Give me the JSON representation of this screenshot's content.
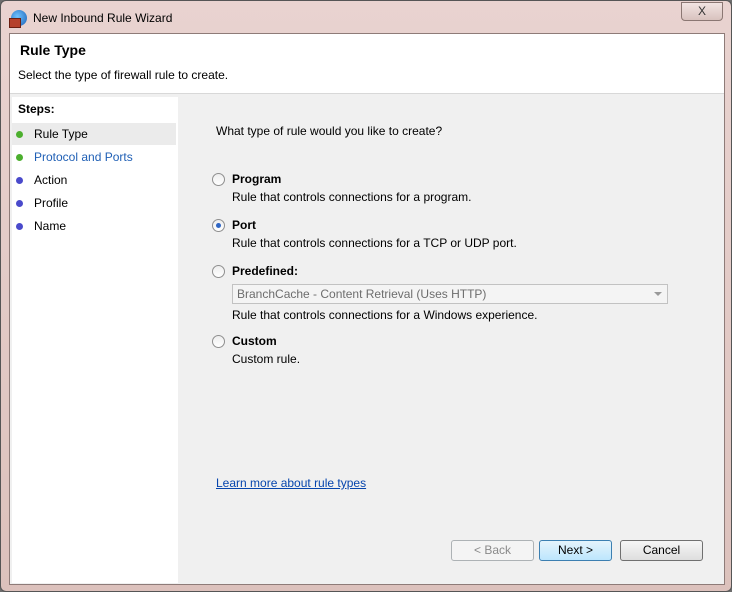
{
  "window": {
    "title": "New Inbound Rule Wizard",
    "close_label": "X"
  },
  "header": {
    "title": "Rule Type",
    "subtitle": "Select the type of firewall rule to create."
  },
  "steps": {
    "label": "Steps:",
    "items": [
      {
        "label": "Rule Type",
        "color": "#4caf2e",
        "selected": true
      },
      {
        "label": "Protocol and Ports",
        "color": "#4caf2e",
        "link": true
      },
      {
        "label": "Action",
        "color": "#4a4acb"
      },
      {
        "label": "Profile",
        "color": "#4a4acb"
      },
      {
        "label": "Name",
        "color": "#4a4acb"
      }
    ]
  },
  "main": {
    "question": "What type of rule would you like to create?",
    "options": [
      {
        "title": "Program",
        "desc": "Rule that controls connections for a program.",
        "checked": false
      },
      {
        "title": "Port",
        "desc": "Rule that controls connections for a TCP or UDP port.",
        "checked": true
      },
      {
        "title": "Predefined:",
        "desc": "Rule that controls connections for a Windows experience.",
        "checked": false
      },
      {
        "title": "Custom",
        "desc": "Custom rule.",
        "checked": false
      }
    ],
    "predefined_value": "BranchCache - Content Retrieval (Uses HTTP)",
    "learn_more": "Learn more about rule types"
  },
  "buttons": {
    "back": "< Back",
    "next": "Next >",
    "cancel": "Cancel"
  }
}
